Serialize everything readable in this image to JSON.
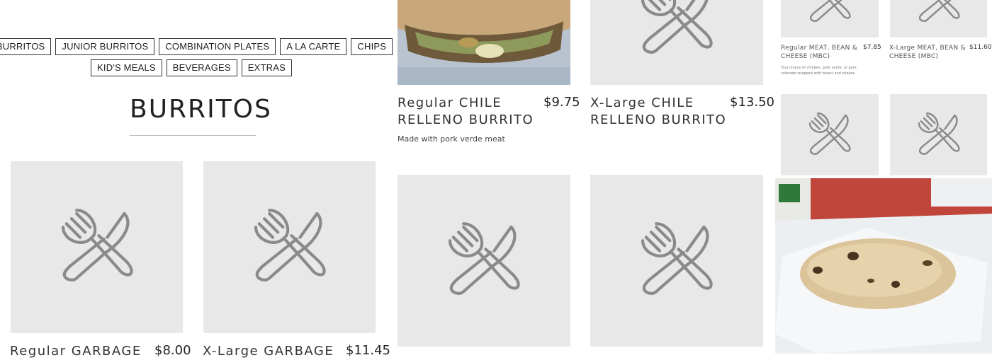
{
  "nav": {
    "row1": [
      "BURRITOS",
      "JUNIOR BURRITOS",
      "COMBINATION PLATES",
      "A LA CARTE",
      "CHIPS"
    ],
    "row2": [
      "KID'S MEALS",
      "BEVERAGES",
      "EXTRAS"
    ]
  },
  "section": {
    "title": "BURRITOS"
  },
  "items": {
    "regular_chile_relleno": {
      "name": "Regular CHILE RELLENO BURRITO",
      "price": "$9.75",
      "description": "Made with pork verde meat"
    },
    "xlarge_chile_relleno": {
      "name": "X-Large CHILE RELLENO BURRITO",
      "price": "$13.50"
    },
    "regular_garbage": {
      "name": "Regular GARBAGE",
      "price": "$8.00"
    },
    "xlarge_garbage": {
      "name": "X-Large GARBAGE",
      "price": "$11.45"
    },
    "regular_mbc": {
      "name": "Regular MEAT, BEAN & CHEESE (MBC)",
      "price": "$7.85",
      "description": "Your choice of chicken, pork verde, or pork colorado wrapped with beans and cheese"
    },
    "xlarge_mbc": {
      "name": "X-Large MEAT, BEAN & CHEESE (MBC)",
      "price": "$11.60"
    }
  },
  "icons": {
    "placeholder": "fork-knife-icon"
  },
  "colors": {
    "placeholder_bg": "#e8e8e8",
    "icon_stroke": "#8a8a8a"
  }
}
